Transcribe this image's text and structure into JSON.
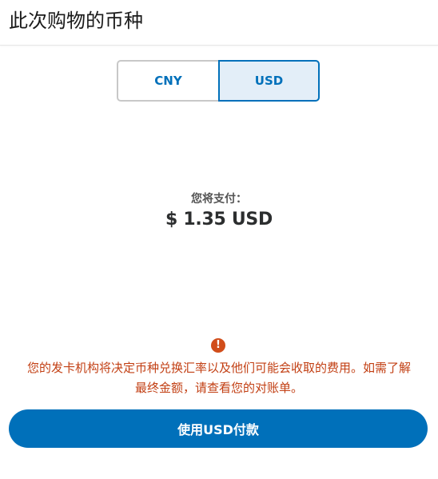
{
  "header": {
    "title": "此次购物的币种"
  },
  "currency_toggle": {
    "options": [
      {
        "label": "CNY",
        "selected": false
      },
      {
        "label": "USD",
        "selected": true
      }
    ]
  },
  "payment": {
    "label": "您将支付：",
    "amount": "$ 1.35 USD"
  },
  "notice": {
    "icon": "exclamation-icon",
    "line1": "您的发卡机构将决定币种兑换汇率以及他们可能会收取的费用。如需了解",
    "line2": "最终金额，请查看您的对账单。",
    "color": "#c23f13"
  },
  "pay_button": {
    "label": "使用USD付款"
  },
  "colors": {
    "accent": "#0070ba",
    "selected_bg": "#e3eef8",
    "warning": "#d14d1a"
  }
}
